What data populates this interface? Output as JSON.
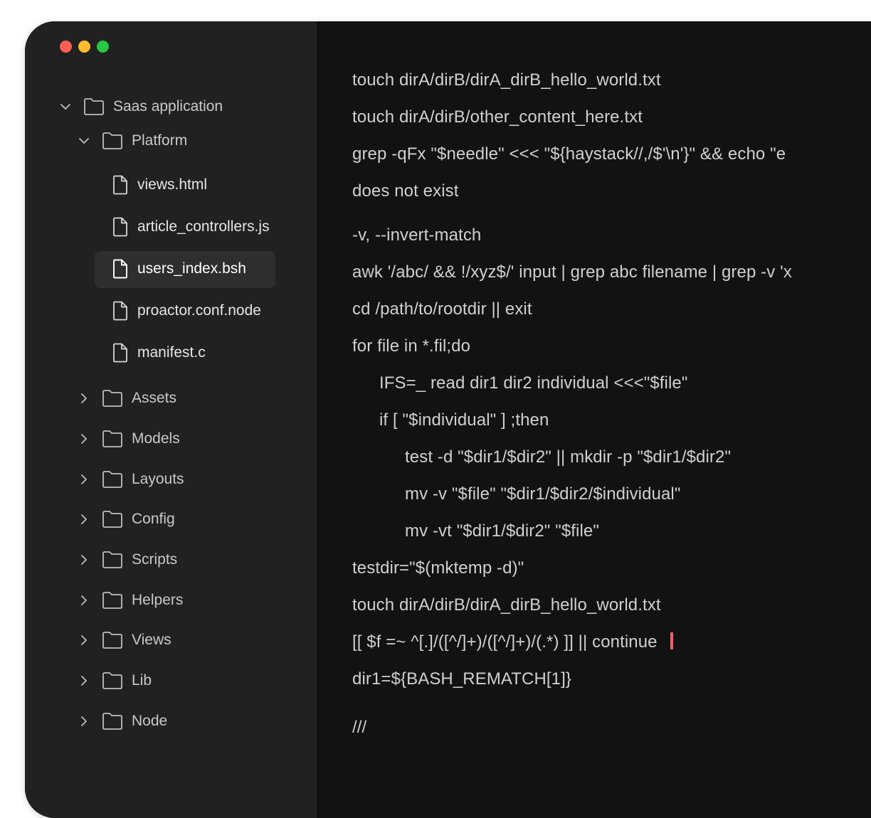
{
  "window": {
    "controls": [
      {
        "name": "close",
        "color": "#ff5f57"
      },
      {
        "name": "minimize",
        "color": "#febc2e"
      },
      {
        "name": "maximize",
        "color": "#28c840"
      }
    ]
  },
  "sidebar": {
    "root": {
      "label": "Saas application",
      "expanded": true,
      "icon": "folder-icon"
    },
    "platform": {
      "label": "Platform",
      "expanded": true,
      "icon": "folder-icon"
    },
    "files": [
      {
        "label": "views.html",
        "icon": "file-icon",
        "selected": false
      },
      {
        "label": "article_controllers.js",
        "icon": "file-icon",
        "selected": false
      },
      {
        "label": "users_index.bsh",
        "icon": "file-icon",
        "selected": true
      },
      {
        "label": "proactor.conf.node",
        "icon": "file-icon",
        "selected": false
      },
      {
        "label": "manifest.c",
        "icon": "file-icon",
        "selected": false
      }
    ],
    "folders": [
      {
        "label": "Assets",
        "expanded": false,
        "icon": "folder-icon"
      },
      {
        "label": "Models",
        "expanded": false,
        "icon": "folder-icon"
      },
      {
        "label": "Layouts",
        "expanded": false,
        "icon": "folder-icon"
      },
      {
        "label": "Config",
        "expanded": false,
        "icon": "folder-icon"
      },
      {
        "label": "Scripts",
        "expanded": false,
        "icon": "folder-icon"
      },
      {
        "label": "Helpers",
        "expanded": false,
        "icon": "folder-icon"
      },
      {
        "label": "Views",
        "expanded": false,
        "icon": "folder-icon"
      },
      {
        "label": "Lib",
        "expanded": false,
        "icon": "folder-icon"
      },
      {
        "label": "Node",
        "expanded": false,
        "icon": "folder-icon"
      }
    ]
  },
  "editor": {
    "lines": [
      "touch dirA/dirB/dirA_dirB_hello_world.txt",
      "touch dirA/dirB/other_content_here.txt",
      "grep -qFx \"$needle\" <<< \"${haystack//,/$'\\n'}\" && echo \"e",
      "does not exist",
      "-v, --invert-match",
      "awk '/abc/ && !/xyz$/' input | grep abc filename | grep -v 'x",
      "cd /path/to/rootdir || exit",
      "for file in *.fil;do",
      "IFS=_ read dir1 dir2 individual <<<\"$file\"",
      "if [ \"$individual\" ] ;then",
      "test -d \"$dir1/$dir2\" || mkdir -p \"$dir1/$dir2\"",
      "mv -v \"$file\" \"$dir1/$dir2/$individual\"",
      "mv -vt \"$dir1/$dir2\" \"$file\"",
      "testdir=\"$(mktemp -d)\"",
      "touch dirA/dirB/dirA_dirB_hello_world.txt",
      "[[ $f =~ ^[.]/([^/]+)/([^/]+)/(.*) ]] || continue",
      "dir1=${BASH_REMATCH[1]}",
      "///"
    ],
    "cursor_color": "#ff5e6c"
  }
}
